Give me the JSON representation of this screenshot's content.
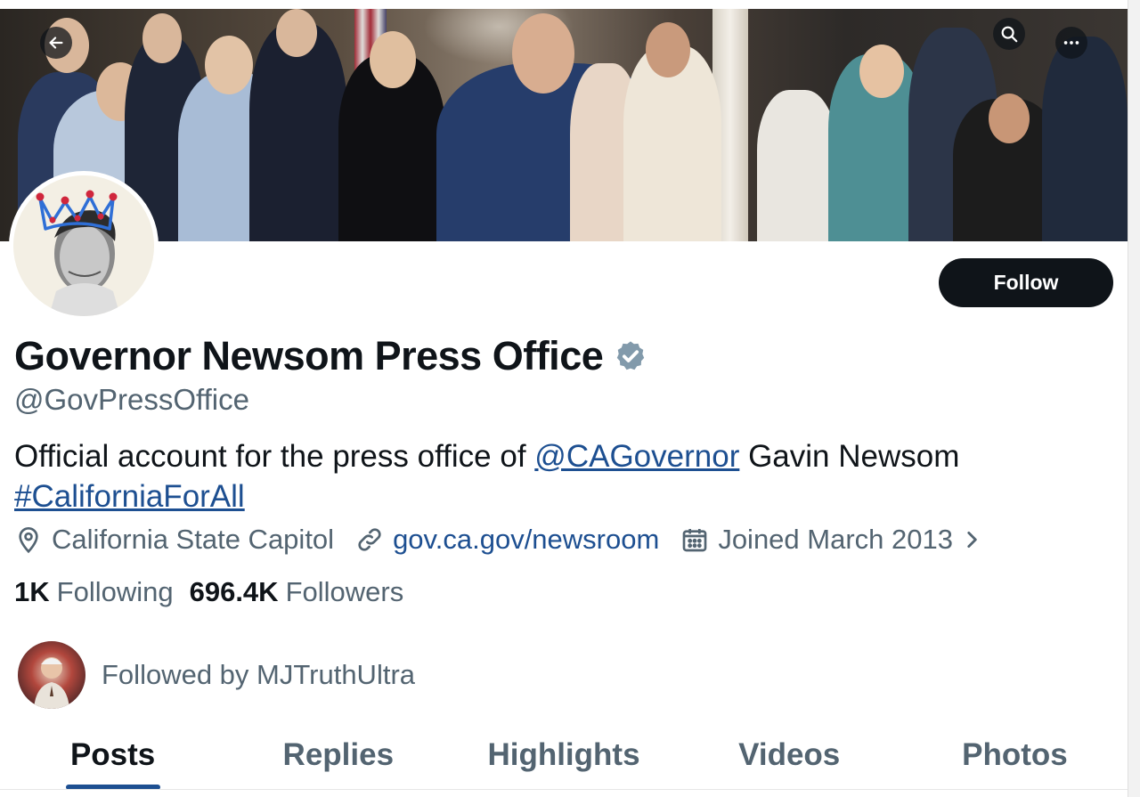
{
  "profile": {
    "name": "Governor Newsom Press Office",
    "handle": "@GovPressOffice",
    "bio_part1": "Official account for the press office of ",
    "bio_mention": "@CAGovernor",
    "bio_part2": " Gavin Newsom",
    "bio_hashtag": "#CaliforniaForAll",
    "location": "California State Capitol",
    "website": "gov.ca.gov/newsroom",
    "joined": "Joined March 2013",
    "following_count": "1K",
    "following_label": "Following",
    "followers_count": "696.4K",
    "followers_label": "Followers",
    "followed_by": "Followed by MJTruthUltra",
    "verified_badge_color": "#829aab"
  },
  "actions": {
    "follow_label": "Follow"
  },
  "header_icons": {
    "back": "back-arrow-icon",
    "search": "search-icon",
    "more": "more-icon"
  },
  "tabs": [
    {
      "label": "Posts",
      "active": true
    },
    {
      "label": "Replies",
      "active": false
    },
    {
      "label": "Highlights",
      "active": false
    },
    {
      "label": "Videos",
      "active": false
    },
    {
      "label": "Photos",
      "active": false
    }
  ],
  "colors": {
    "link": "#1d4f91",
    "text": "#0f1419",
    "secondary": "#536471",
    "button": "#0f1419"
  }
}
